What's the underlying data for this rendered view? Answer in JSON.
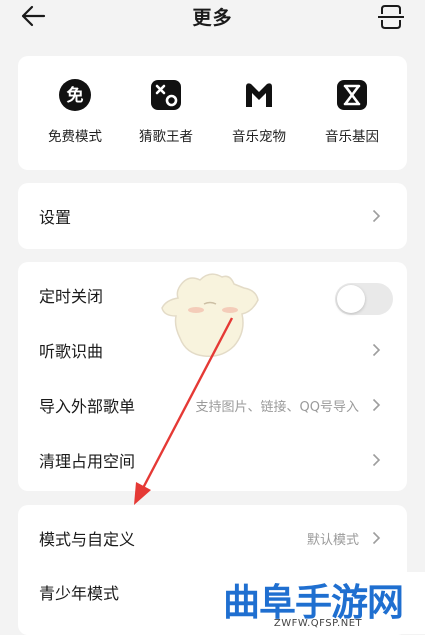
{
  "header": {
    "title": "更多",
    "back_icon": "back-arrow-icon",
    "scan_icon": "scan-icon"
  },
  "features": [
    {
      "label": "免费模式",
      "icon": "free-mode-icon",
      "glyph": "免"
    },
    {
      "label": "猜歌王者",
      "icon": "guess-song-icon"
    },
    {
      "label": "音乐宠物",
      "icon": "music-pet-icon"
    },
    {
      "label": "音乐基因",
      "icon": "music-gene-icon"
    }
  ],
  "settings_row": {
    "label": "设置"
  },
  "tools": [
    {
      "label": "定时关闭",
      "type": "toggle",
      "enabled": false
    },
    {
      "label": "听歌识曲",
      "type": "link"
    },
    {
      "label": "导入外部歌单",
      "type": "link",
      "hint": "支持图片、链接、QQ号导入"
    },
    {
      "label": "清理占用空间",
      "type": "link"
    }
  ],
  "modes": [
    {
      "label": "模式与自定义",
      "hint": "默认模式"
    },
    {
      "label": "青少年模式"
    }
  ],
  "watermark": {
    "text": "曲阜手游网",
    "url": "ZWFW.QFSP.NET"
  },
  "colors": {
    "background": "#f3f3f3",
    "card": "#ffffff",
    "arrow": "#e53935",
    "watermark": "#1f6fd0",
    "toggle_off": "#e9e9e9"
  }
}
